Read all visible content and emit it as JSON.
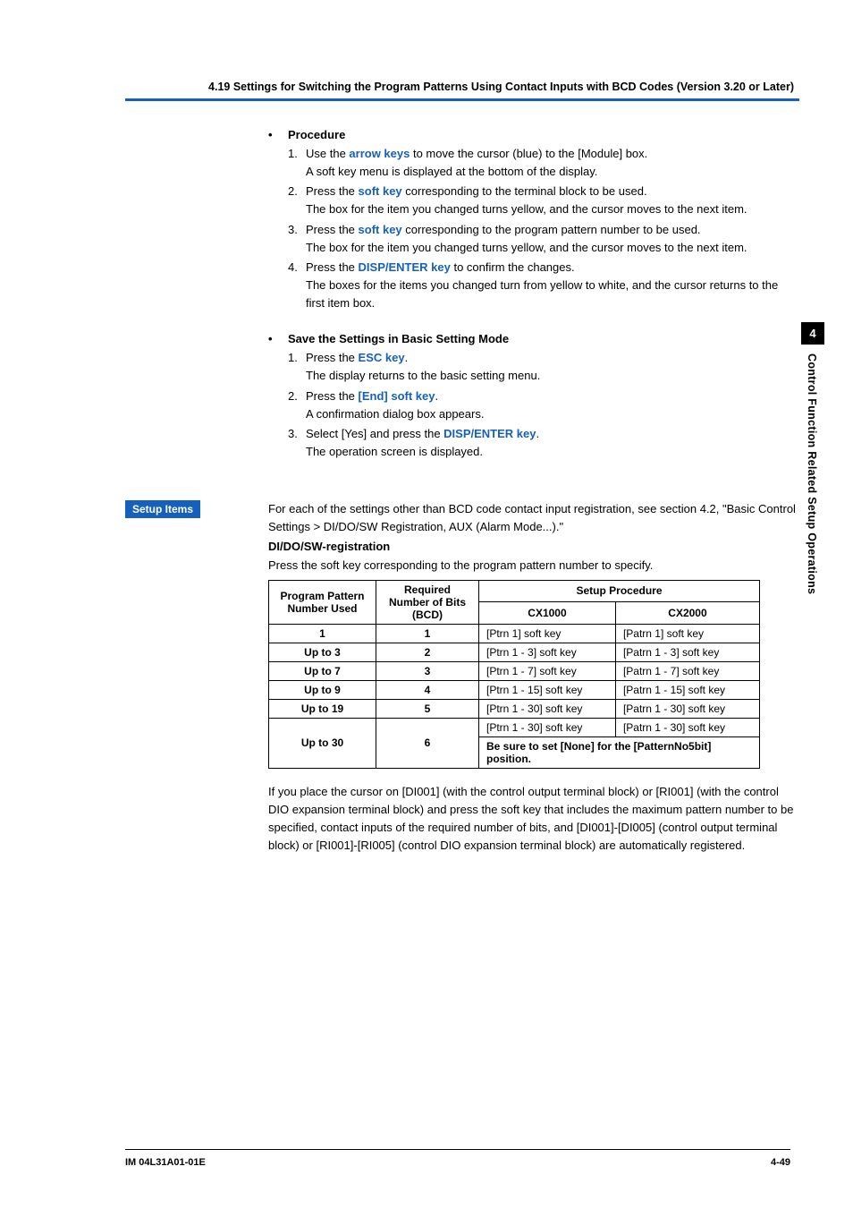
{
  "header": {
    "title": "4.19  Settings for Switching the Program Patterns Using Contact Inputs with BCD Codes (Version 3.20 or Later)"
  },
  "procedure": {
    "title": "Procedure",
    "items": [
      {
        "num": "1.",
        "pre": "Use the ",
        "key": "arrow keys",
        "post": " to move the cursor (blue) to the [Module] box.",
        "cont": "A soft key menu is displayed at the bottom of the display."
      },
      {
        "num": "2.",
        "pre": "Press the ",
        "key": "soft key",
        "post": " corresponding to the terminal block to be used.",
        "cont": "The box for the item you changed turns yellow, and the cursor moves to the next item."
      },
      {
        "num": "3.",
        "pre": "Press the ",
        "key": "soft key",
        "post": " corresponding to the program pattern number to be used.",
        "cont": "The box for the item you changed turns yellow, and the cursor moves to the next item."
      },
      {
        "num": "4.",
        "pre": "Press the ",
        "key": "DISP/ENTER key",
        "post": " to confirm the changes.",
        "cont": "The boxes for the items you changed turn from yellow to white, and the cursor returns to the first item box."
      }
    ]
  },
  "save": {
    "title": "Save the Settings in Basic Setting Mode",
    "items": [
      {
        "num": "1.",
        "pre": "Press the ",
        "key": "ESC key",
        "post": ".",
        "cont": "The display returns to the basic setting menu."
      },
      {
        "num": "2.",
        "pre": "Press the ",
        "key": "[End] soft key",
        "post": ".",
        "cont": "A confirmation dialog box appears."
      },
      {
        "num": "3.",
        "pre": "Select [Yes] and press the ",
        "key": "DISP/ENTER key",
        "post": ".",
        "cont": "The operation screen is displayed."
      }
    ]
  },
  "setup": {
    "tag": "Setup Items",
    "intro": "For each of the settings other than BCD code contact input registration, see section 4.2, \"Basic Control Settings > DI/DO/SW Registration, AUX (Alarm Mode...).\"",
    "heading": "DI/DO/SW-registration",
    "subline": "Press the soft key corresponding to the program pattern number to specify.",
    "table": {
      "h1": "Program Pattern Number Used",
      "h2": "Required Number of Bits (BCD)",
      "h3": "Setup Procedure",
      "h3a": "CX1000",
      "h3b": "CX2000",
      "rows": [
        {
          "c1": "1",
          "c2": "1",
          "c3": "[Ptrn 1] soft key",
          "c4": "[Patrn 1] soft key"
        },
        {
          "c1": "Up to 3",
          "c2": "2",
          "c3": "[Ptrn 1 - 3] soft key",
          "c4": "[Patrn 1 - 3] soft key"
        },
        {
          "c1": "Up to 7",
          "c2": "3",
          "c3": "[Ptrn 1 - 7] soft key",
          "c4": "[Patrn 1 - 7] soft key"
        },
        {
          "c1": "Up to 9",
          "c2": "4",
          "c3": "[Ptrn 1 - 15] soft key",
          "c4": "[Patrn 1 - 15] soft key"
        },
        {
          "c1": "Up to 19",
          "c2": "5",
          "c3": "[Ptrn 1 - 30] soft key",
          "c4": "[Patrn 1 - 30] soft key"
        }
      ],
      "last": {
        "c1": "Up to 30",
        "c2": "6",
        "c3": "[Ptrn 1 - 30] soft key",
        "c4": "[Patrn 1 - 30] soft key",
        "note": "Be sure to set [None] for the [PatternNo5bit] position."
      }
    },
    "outro": "If you place the cursor on [DI001] (with the control output terminal block) or [RI001] (with the control DIO expansion terminal block) and press the soft key that includes the maximum pattern number to be specified, contact inputs of the required number of bits, and [DI001]-[DI005] (control output terminal block) or [RI001]-[RI005] (control DIO expansion terminal block) are automatically registered."
  },
  "sidetab": {
    "num": "4",
    "text": "Control Function Related Setup Operations"
  },
  "footer": {
    "left": "IM 04L31A01-01E",
    "right": "4-49"
  }
}
